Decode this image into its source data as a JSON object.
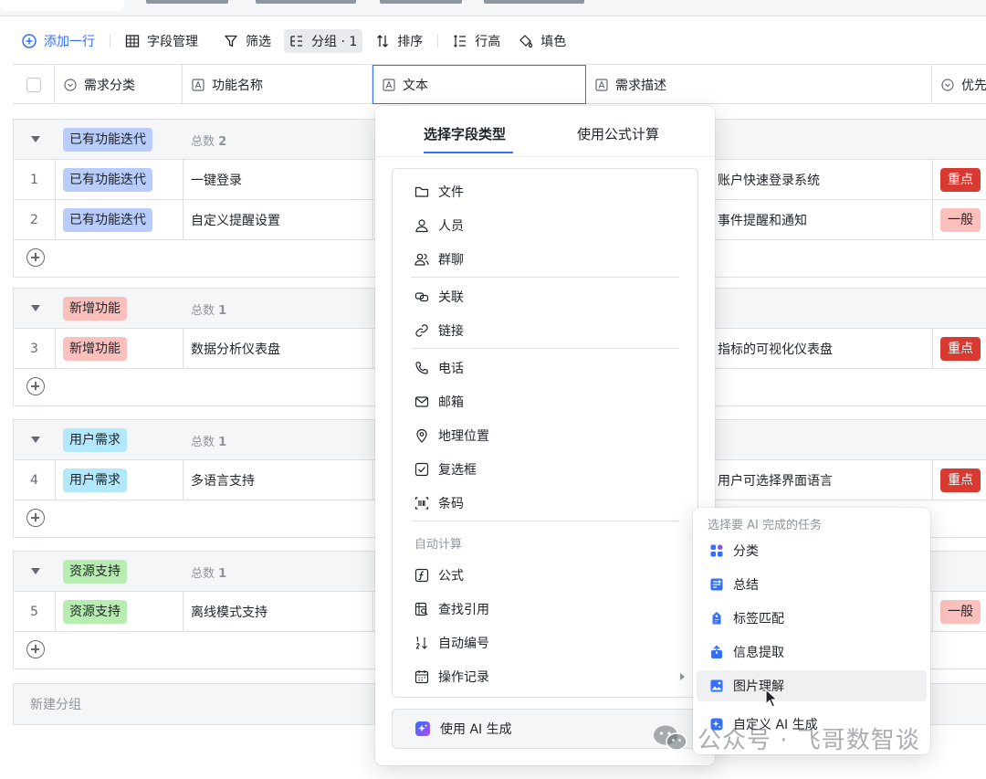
{
  "toolbar": {
    "add_row": "添加一行",
    "field_manage": "字段管理",
    "filter": "筛选",
    "group": "分组 · 1",
    "sort": "排序",
    "row_height": "行高",
    "fill_color": "填色"
  },
  "columns": {
    "category": "需求分类",
    "feature_name": "功能名称",
    "text": "文本",
    "description": "需求描述",
    "priority": "优先"
  },
  "group_count_label": "总数",
  "groups": [
    {
      "name": "已有功能迭代",
      "color": "#b8cdfb",
      "count": "2",
      "rows": [
        {
          "num": "1",
          "category": "已有功能迭代",
          "feature": "一键登录",
          "desc": "账户快速登录系统",
          "priority": "重点",
          "priority_level": "high"
        },
        {
          "num": "2",
          "category": "已有功能迭代",
          "feature": "自定义提醒设置",
          "desc": "事件提醒和通知",
          "priority": "一般",
          "priority_level": "normal"
        }
      ]
    },
    {
      "name": "新增功能",
      "color": "#fbbfbc",
      "count": "1",
      "rows": [
        {
          "num": "3",
          "category": "新增功能",
          "feature": "数据分析仪表盘",
          "desc": "指标的可视化仪表盘",
          "priority": "重点",
          "priority_level": "high"
        }
      ]
    },
    {
      "name": "用户需求",
      "color": "#b1e8fc",
      "count": "1",
      "rows": [
        {
          "num": "4",
          "category": "用户需求",
          "feature": "多语言支持",
          "desc": "用户可选择界面语言",
          "priority": "重点",
          "priority_level": "high"
        }
      ]
    },
    {
      "name": "资源支持",
      "color": "#b7edb1",
      "count": "1",
      "rows": [
        {
          "num": "5",
          "category": "资源支持",
          "feature": "离线模式支持",
          "desc": "",
          "priority": "一般",
          "priority_level": "normal"
        }
      ]
    }
  ],
  "new_group": "新建分组",
  "field_panel": {
    "tab_select_type": "选择字段类型",
    "tab_formula": "使用公式计算",
    "items": {
      "file": "文件",
      "person": "人员",
      "group_chat": "群聊",
      "link_record": "关联",
      "url": "链接",
      "phone": "电话",
      "email": "邮箱",
      "location": "地理位置",
      "checkbox": "复选框",
      "barcode": "条码",
      "formula": "公式",
      "lookup": "查找引用",
      "auto_number": "自动编号",
      "operation_log": "操作记录"
    },
    "section_auto": "自动计算",
    "ai_generate": "使用 AI 生成"
  },
  "ai_menu": {
    "title": "选择要 AI 完成的任务",
    "classify": "分类",
    "summarize": "总结",
    "tag_match": "标签匹配",
    "extract": "信息提取",
    "image_understand": "图片理解",
    "custom_ai": "自定义 AI 生成"
  },
  "watermark": "公众号 · 飞哥数智谈",
  "colors": {
    "accent": "#3370ff",
    "priority_high": "#d83931",
    "priority_normal": "#fbbfbc"
  }
}
